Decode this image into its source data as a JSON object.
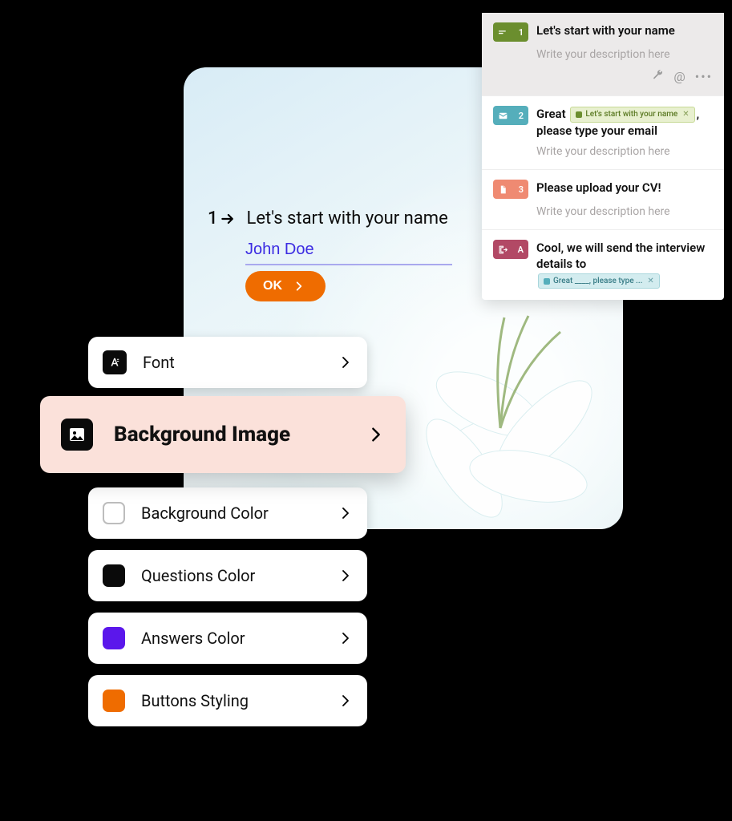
{
  "preview": {
    "question_number": "1",
    "question_text": "Let's start with your name",
    "answer_value": "John Doe",
    "ok_label": "OK"
  },
  "panel": {
    "items": [
      {
        "badge_num": "1",
        "title": "Let's start with your name",
        "description_placeholder": "Write your description here"
      },
      {
        "badge_num": "2",
        "title_prefix": "Great",
        "chip_text": "Let's start with your name",
        "title_suffix": ", please type your email",
        "description_placeholder": "Write your description here"
      },
      {
        "badge_num": "3",
        "title": "Please upload your CV!",
        "description_placeholder": "Write your description here"
      },
      {
        "badge_num": "A",
        "title_prefix": "Cool, we will send the interview details to",
        "chip_text": "Great ____, please type ..."
      }
    ]
  },
  "settings": {
    "font": "Font",
    "background_image": "Background Image",
    "background_color": "Background Color",
    "questions_color": "Questions Color",
    "answers_color": "Answers Color",
    "buttons_styling": "Buttons Styling"
  },
  "colors": {
    "buttons": "#ef6c00",
    "answers": "#5b17eb",
    "questions": "#0a0a0a"
  }
}
